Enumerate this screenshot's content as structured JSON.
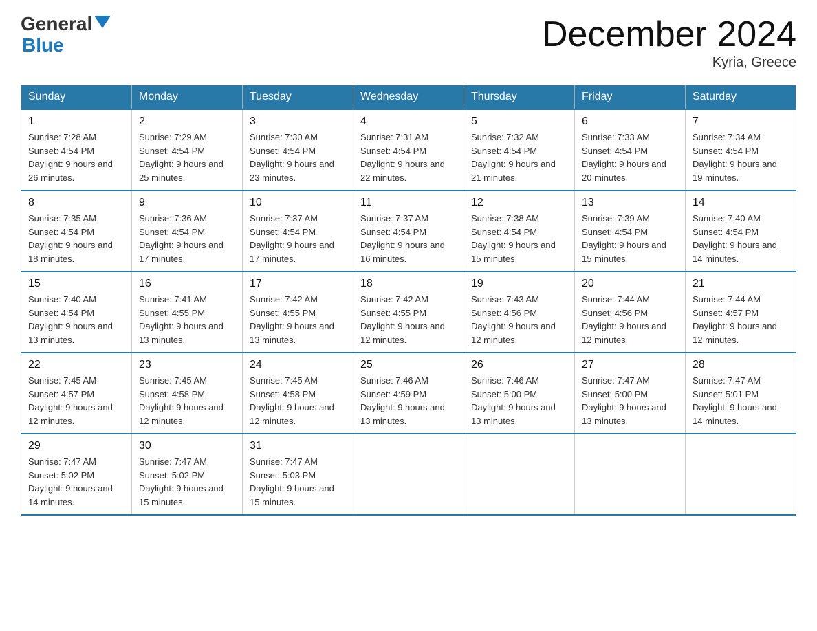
{
  "header": {
    "logo_general": "General",
    "logo_blue": "Blue",
    "month_title": "December 2024",
    "location": "Kyria, Greece"
  },
  "columns": [
    "Sunday",
    "Monday",
    "Tuesday",
    "Wednesday",
    "Thursday",
    "Friday",
    "Saturday"
  ],
  "weeks": [
    [
      {
        "day": "1",
        "sunrise": "7:28 AM",
        "sunset": "4:54 PM",
        "daylight": "9 hours and 26 minutes."
      },
      {
        "day": "2",
        "sunrise": "7:29 AM",
        "sunset": "4:54 PM",
        "daylight": "9 hours and 25 minutes."
      },
      {
        "day": "3",
        "sunrise": "7:30 AM",
        "sunset": "4:54 PM",
        "daylight": "9 hours and 23 minutes."
      },
      {
        "day": "4",
        "sunrise": "7:31 AM",
        "sunset": "4:54 PM",
        "daylight": "9 hours and 22 minutes."
      },
      {
        "day": "5",
        "sunrise": "7:32 AM",
        "sunset": "4:54 PM",
        "daylight": "9 hours and 21 minutes."
      },
      {
        "day": "6",
        "sunrise": "7:33 AM",
        "sunset": "4:54 PM",
        "daylight": "9 hours and 20 minutes."
      },
      {
        "day": "7",
        "sunrise": "7:34 AM",
        "sunset": "4:54 PM",
        "daylight": "9 hours and 19 minutes."
      }
    ],
    [
      {
        "day": "8",
        "sunrise": "7:35 AM",
        "sunset": "4:54 PM",
        "daylight": "9 hours and 18 minutes."
      },
      {
        "day": "9",
        "sunrise": "7:36 AM",
        "sunset": "4:54 PM",
        "daylight": "9 hours and 17 minutes."
      },
      {
        "day": "10",
        "sunrise": "7:37 AM",
        "sunset": "4:54 PM",
        "daylight": "9 hours and 17 minutes."
      },
      {
        "day": "11",
        "sunrise": "7:37 AM",
        "sunset": "4:54 PM",
        "daylight": "9 hours and 16 minutes."
      },
      {
        "day": "12",
        "sunrise": "7:38 AM",
        "sunset": "4:54 PM",
        "daylight": "9 hours and 15 minutes."
      },
      {
        "day": "13",
        "sunrise": "7:39 AM",
        "sunset": "4:54 PM",
        "daylight": "9 hours and 15 minutes."
      },
      {
        "day": "14",
        "sunrise": "7:40 AM",
        "sunset": "4:54 PM",
        "daylight": "9 hours and 14 minutes."
      }
    ],
    [
      {
        "day": "15",
        "sunrise": "7:40 AM",
        "sunset": "4:54 PM",
        "daylight": "9 hours and 13 minutes."
      },
      {
        "day": "16",
        "sunrise": "7:41 AM",
        "sunset": "4:55 PM",
        "daylight": "9 hours and 13 minutes."
      },
      {
        "day": "17",
        "sunrise": "7:42 AM",
        "sunset": "4:55 PM",
        "daylight": "9 hours and 13 minutes."
      },
      {
        "day": "18",
        "sunrise": "7:42 AM",
        "sunset": "4:55 PM",
        "daylight": "9 hours and 12 minutes."
      },
      {
        "day": "19",
        "sunrise": "7:43 AM",
        "sunset": "4:56 PM",
        "daylight": "9 hours and 12 minutes."
      },
      {
        "day": "20",
        "sunrise": "7:44 AM",
        "sunset": "4:56 PM",
        "daylight": "9 hours and 12 minutes."
      },
      {
        "day": "21",
        "sunrise": "7:44 AM",
        "sunset": "4:57 PM",
        "daylight": "9 hours and 12 minutes."
      }
    ],
    [
      {
        "day": "22",
        "sunrise": "7:45 AM",
        "sunset": "4:57 PM",
        "daylight": "9 hours and 12 minutes."
      },
      {
        "day": "23",
        "sunrise": "7:45 AM",
        "sunset": "4:58 PM",
        "daylight": "9 hours and 12 minutes."
      },
      {
        "day": "24",
        "sunrise": "7:45 AM",
        "sunset": "4:58 PM",
        "daylight": "9 hours and 12 minutes."
      },
      {
        "day": "25",
        "sunrise": "7:46 AM",
        "sunset": "4:59 PM",
        "daylight": "9 hours and 13 minutes."
      },
      {
        "day": "26",
        "sunrise": "7:46 AM",
        "sunset": "5:00 PM",
        "daylight": "9 hours and 13 minutes."
      },
      {
        "day": "27",
        "sunrise": "7:47 AM",
        "sunset": "5:00 PM",
        "daylight": "9 hours and 13 minutes."
      },
      {
        "day": "28",
        "sunrise": "7:47 AM",
        "sunset": "5:01 PM",
        "daylight": "9 hours and 14 minutes."
      }
    ],
    [
      {
        "day": "29",
        "sunrise": "7:47 AM",
        "sunset": "5:02 PM",
        "daylight": "9 hours and 14 minutes."
      },
      {
        "day": "30",
        "sunrise": "7:47 AM",
        "sunset": "5:02 PM",
        "daylight": "9 hours and 15 minutes."
      },
      {
        "day": "31",
        "sunrise": "7:47 AM",
        "sunset": "5:03 PM",
        "daylight": "9 hours and 15 minutes."
      },
      null,
      null,
      null,
      null
    ]
  ]
}
